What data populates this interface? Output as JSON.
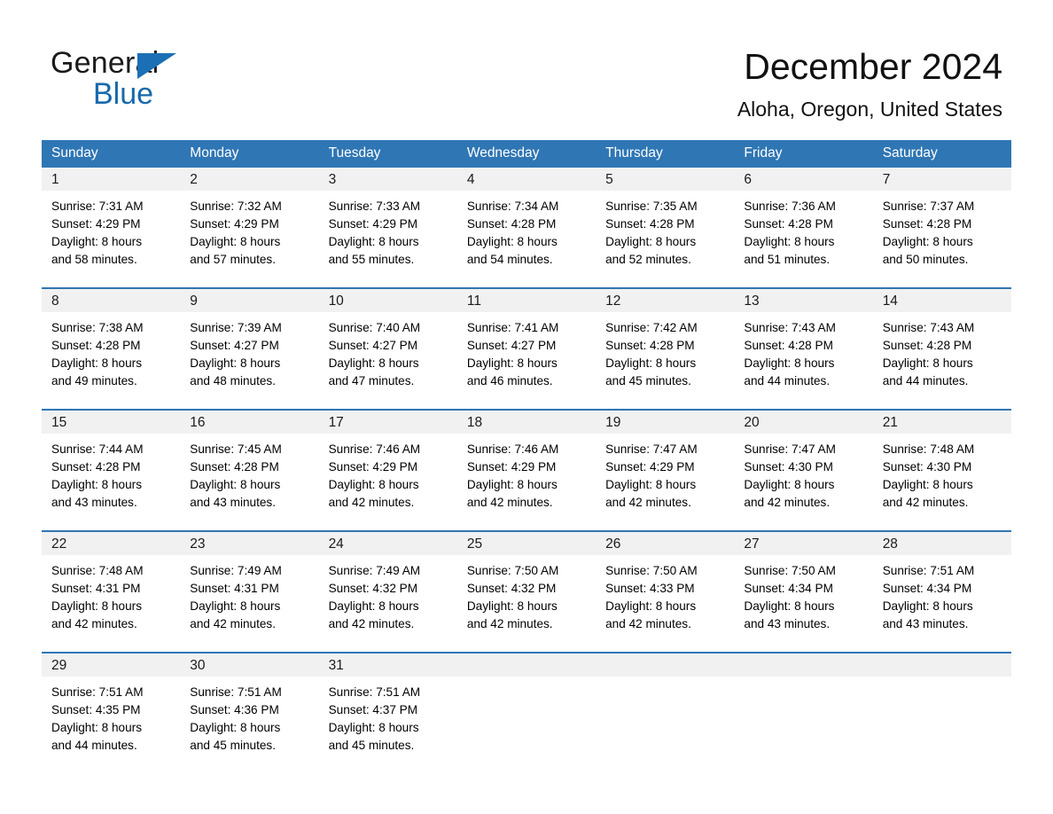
{
  "brand": {
    "name_top": "General",
    "name_bottom": "Blue",
    "triangle_color": "#1a6fb5",
    "blue_color": "#1769ad"
  },
  "header": {
    "title": "December 2024",
    "location": "Aloha, Oregon, United States"
  },
  "theme": {
    "header_blue": "#2f76b4",
    "daynum_band": "#f1f1f1",
    "page_background": "#ffffff",
    "text": "#000000"
  },
  "weekday_headers": [
    "Sunday",
    "Monday",
    "Tuesday",
    "Wednesday",
    "Thursday",
    "Friday",
    "Saturday"
  ],
  "weeks": [
    [
      {
        "day": "1",
        "sunrise": "Sunrise: 7:31 AM",
        "sunset": "Sunset: 4:29 PM",
        "daylight_line1": "Daylight: 8 hours",
        "daylight_line2": "and 58 minutes."
      },
      {
        "day": "2",
        "sunrise": "Sunrise: 7:32 AM",
        "sunset": "Sunset: 4:29 PM",
        "daylight_line1": "Daylight: 8 hours",
        "daylight_line2": "and 57 minutes."
      },
      {
        "day": "3",
        "sunrise": "Sunrise: 7:33 AM",
        "sunset": "Sunset: 4:29 PM",
        "daylight_line1": "Daylight: 8 hours",
        "daylight_line2": "and 55 minutes."
      },
      {
        "day": "4",
        "sunrise": "Sunrise: 7:34 AM",
        "sunset": "Sunset: 4:28 PM",
        "daylight_line1": "Daylight: 8 hours",
        "daylight_line2": "and 54 minutes."
      },
      {
        "day": "5",
        "sunrise": "Sunrise: 7:35 AM",
        "sunset": "Sunset: 4:28 PM",
        "daylight_line1": "Daylight: 8 hours",
        "daylight_line2": "and 52 minutes."
      },
      {
        "day": "6",
        "sunrise": "Sunrise: 7:36 AM",
        "sunset": "Sunset: 4:28 PM",
        "daylight_line1": "Daylight: 8 hours",
        "daylight_line2": "and 51 minutes."
      },
      {
        "day": "7",
        "sunrise": "Sunrise: 7:37 AM",
        "sunset": "Sunset: 4:28 PM",
        "daylight_line1": "Daylight: 8 hours",
        "daylight_line2": "and 50 minutes."
      }
    ],
    [
      {
        "day": "8",
        "sunrise": "Sunrise: 7:38 AM",
        "sunset": "Sunset: 4:28 PM",
        "daylight_line1": "Daylight: 8 hours",
        "daylight_line2": "and 49 minutes."
      },
      {
        "day": "9",
        "sunrise": "Sunrise: 7:39 AM",
        "sunset": "Sunset: 4:27 PM",
        "daylight_line1": "Daylight: 8 hours",
        "daylight_line2": "and 48 minutes."
      },
      {
        "day": "10",
        "sunrise": "Sunrise: 7:40 AM",
        "sunset": "Sunset: 4:27 PM",
        "daylight_line1": "Daylight: 8 hours",
        "daylight_line2": "and 47 minutes."
      },
      {
        "day": "11",
        "sunrise": "Sunrise: 7:41 AM",
        "sunset": "Sunset: 4:27 PM",
        "daylight_line1": "Daylight: 8 hours",
        "daylight_line2": "and 46 minutes."
      },
      {
        "day": "12",
        "sunrise": "Sunrise: 7:42 AM",
        "sunset": "Sunset: 4:28 PM",
        "daylight_line1": "Daylight: 8 hours",
        "daylight_line2": "and 45 minutes."
      },
      {
        "day": "13",
        "sunrise": "Sunrise: 7:43 AM",
        "sunset": "Sunset: 4:28 PM",
        "daylight_line1": "Daylight: 8 hours",
        "daylight_line2": "and 44 minutes."
      },
      {
        "day": "14",
        "sunrise": "Sunrise: 7:43 AM",
        "sunset": "Sunset: 4:28 PM",
        "daylight_line1": "Daylight: 8 hours",
        "daylight_line2": "and 44 minutes."
      }
    ],
    [
      {
        "day": "15",
        "sunrise": "Sunrise: 7:44 AM",
        "sunset": "Sunset: 4:28 PM",
        "daylight_line1": "Daylight: 8 hours",
        "daylight_line2": "and 43 minutes."
      },
      {
        "day": "16",
        "sunrise": "Sunrise: 7:45 AM",
        "sunset": "Sunset: 4:28 PM",
        "daylight_line1": "Daylight: 8 hours",
        "daylight_line2": "and 43 minutes."
      },
      {
        "day": "17",
        "sunrise": "Sunrise: 7:46 AM",
        "sunset": "Sunset: 4:29 PM",
        "daylight_line1": "Daylight: 8 hours",
        "daylight_line2": "and 42 minutes."
      },
      {
        "day": "18",
        "sunrise": "Sunrise: 7:46 AM",
        "sunset": "Sunset: 4:29 PM",
        "daylight_line1": "Daylight: 8 hours",
        "daylight_line2": "and 42 minutes."
      },
      {
        "day": "19",
        "sunrise": "Sunrise: 7:47 AM",
        "sunset": "Sunset: 4:29 PM",
        "daylight_line1": "Daylight: 8 hours",
        "daylight_line2": "and 42 minutes."
      },
      {
        "day": "20",
        "sunrise": "Sunrise: 7:47 AM",
        "sunset": "Sunset: 4:30 PM",
        "daylight_line1": "Daylight: 8 hours",
        "daylight_line2": "and 42 minutes."
      },
      {
        "day": "21",
        "sunrise": "Sunrise: 7:48 AM",
        "sunset": "Sunset: 4:30 PM",
        "daylight_line1": "Daylight: 8 hours",
        "daylight_line2": "and 42 minutes."
      }
    ],
    [
      {
        "day": "22",
        "sunrise": "Sunrise: 7:48 AM",
        "sunset": "Sunset: 4:31 PM",
        "daylight_line1": "Daylight: 8 hours",
        "daylight_line2": "and 42 minutes."
      },
      {
        "day": "23",
        "sunrise": "Sunrise: 7:49 AM",
        "sunset": "Sunset: 4:31 PM",
        "daylight_line1": "Daylight: 8 hours",
        "daylight_line2": "and 42 minutes."
      },
      {
        "day": "24",
        "sunrise": "Sunrise: 7:49 AM",
        "sunset": "Sunset: 4:32 PM",
        "daylight_line1": "Daylight: 8 hours",
        "daylight_line2": "and 42 minutes."
      },
      {
        "day": "25",
        "sunrise": "Sunrise: 7:50 AM",
        "sunset": "Sunset: 4:32 PM",
        "daylight_line1": "Daylight: 8 hours",
        "daylight_line2": "and 42 minutes."
      },
      {
        "day": "26",
        "sunrise": "Sunrise: 7:50 AM",
        "sunset": "Sunset: 4:33 PM",
        "daylight_line1": "Daylight: 8 hours",
        "daylight_line2": "and 42 minutes."
      },
      {
        "day": "27",
        "sunrise": "Sunrise: 7:50 AM",
        "sunset": "Sunset: 4:34 PM",
        "daylight_line1": "Daylight: 8 hours",
        "daylight_line2": "and 43 minutes."
      },
      {
        "day": "28",
        "sunrise": "Sunrise: 7:51 AM",
        "sunset": "Sunset: 4:34 PM",
        "daylight_line1": "Daylight: 8 hours",
        "daylight_line2": "and 43 minutes."
      }
    ],
    [
      {
        "day": "29",
        "sunrise": "Sunrise: 7:51 AM",
        "sunset": "Sunset: 4:35 PM",
        "daylight_line1": "Daylight: 8 hours",
        "daylight_line2": "and 44 minutes."
      },
      {
        "day": "30",
        "sunrise": "Sunrise: 7:51 AM",
        "sunset": "Sunset: 4:36 PM",
        "daylight_line1": "Daylight: 8 hours",
        "daylight_line2": "and 45 minutes."
      },
      {
        "day": "31",
        "sunrise": "Sunrise: 7:51 AM",
        "sunset": "Sunset: 4:37 PM",
        "daylight_line1": "Daylight: 8 hours",
        "daylight_line2": "and 45 minutes."
      },
      {
        "day": "",
        "sunrise": "",
        "sunset": "",
        "daylight_line1": "",
        "daylight_line2": ""
      },
      {
        "day": "",
        "sunrise": "",
        "sunset": "",
        "daylight_line1": "",
        "daylight_line2": ""
      },
      {
        "day": "",
        "sunrise": "",
        "sunset": "",
        "daylight_line1": "",
        "daylight_line2": ""
      },
      {
        "day": "",
        "sunrise": "",
        "sunset": "",
        "daylight_line1": "",
        "daylight_line2": ""
      }
    ]
  ]
}
